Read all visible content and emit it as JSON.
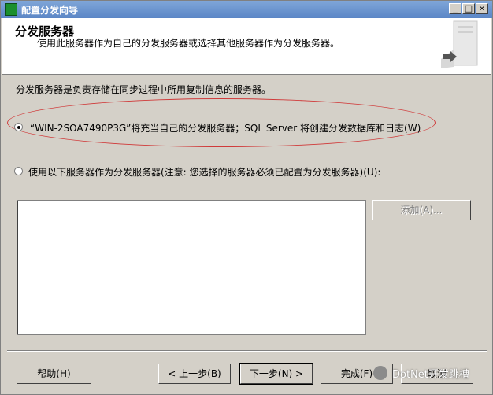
{
  "window": {
    "title": "配置分发向导",
    "controls": {
      "minimize": "_",
      "maximize": "□",
      "close": "×"
    }
  },
  "header": {
    "title": "分发服务器",
    "subtitle": "使用此服务器作为自己的分发服务器或选择其他服务器作为分发服务器。"
  },
  "body": {
    "description": "分发服务器是负责存储在同步过程中所用复制信息的服务器。",
    "option1": {
      "label": "“WIN-2SOA7490P3G”将充当自己的分发服务器；SQL Server 将创建分发数据库和日志(W)",
      "selected": true
    },
    "option2": {
      "label": "使用以下服务器作为分发服务器(注意: 您选择的服务器必须已配置为分发服务器)(U):",
      "selected": false
    },
    "add_button": "添加(A)..."
  },
  "footer": {
    "help": "帮助(H)",
    "back": "< 上一步(B)",
    "next": "下一步(N) >",
    "finish": "完成(F)",
    "cancel": "取消"
  },
  "overlay": {
    "watermark_text": "DotNet开发跳槽",
    "annotation_color": "#d03a3a"
  }
}
